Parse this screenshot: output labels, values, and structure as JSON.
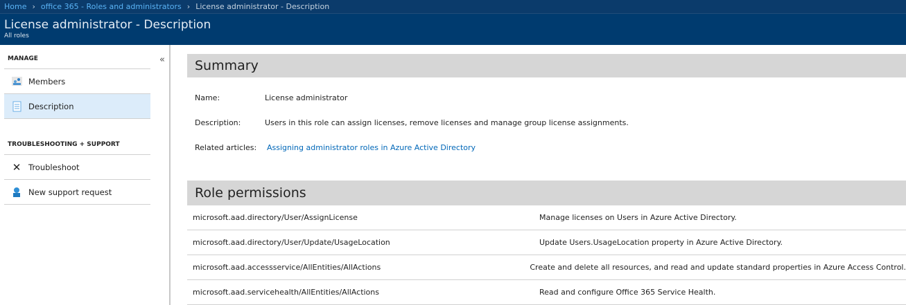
{
  "breadcrumb": [
    "Home",
    "office 365 - Roles and administrators",
    "License administrator - Description"
  ],
  "header": {
    "title": "License administrator - Description",
    "subtitle": "All roles"
  },
  "sidebar": {
    "manage_label": "MANAGE",
    "items": [
      {
        "label": "Members",
        "icon": "members-icon"
      },
      {
        "label": "Description",
        "icon": "document-icon",
        "active": true
      }
    ],
    "support_label": "TROUBLESHOOTING + SUPPORT",
    "support_items": [
      {
        "label": "Troubleshoot",
        "icon": "tools-icon"
      },
      {
        "label": "New support request",
        "icon": "support-icon"
      }
    ],
    "collapse": "«"
  },
  "summary": {
    "title": "Summary",
    "name_label": "Name:",
    "name": "License administrator",
    "description_label": "Description:",
    "description": "Users in this role can assign licenses, remove licenses and manage group license assignments.",
    "articles_label": "Related articles:",
    "article_link": "Assigning administrator roles in Azure Active Directory"
  },
  "permissions": {
    "title": "Role permissions",
    "rows": [
      {
        "action": "microsoft.aad.directory/User/AssignLicense",
        "description": "Manage licenses on Users in Azure Active Directory."
      },
      {
        "action": "microsoft.aad.directory/User/Update/UsageLocation",
        "description": "Update Users.UsageLocation property in Azure Active Directory."
      },
      {
        "action": "microsoft.aad.accessservice/AllEntities/AllActions",
        "description": "Create and delete all resources, and read and update standard properties in Azure Access Control."
      },
      {
        "action": "microsoft.aad.servicehealth/AllEntities/AllActions",
        "description": "Read and configure Office 365 Service Health."
      }
    ]
  }
}
